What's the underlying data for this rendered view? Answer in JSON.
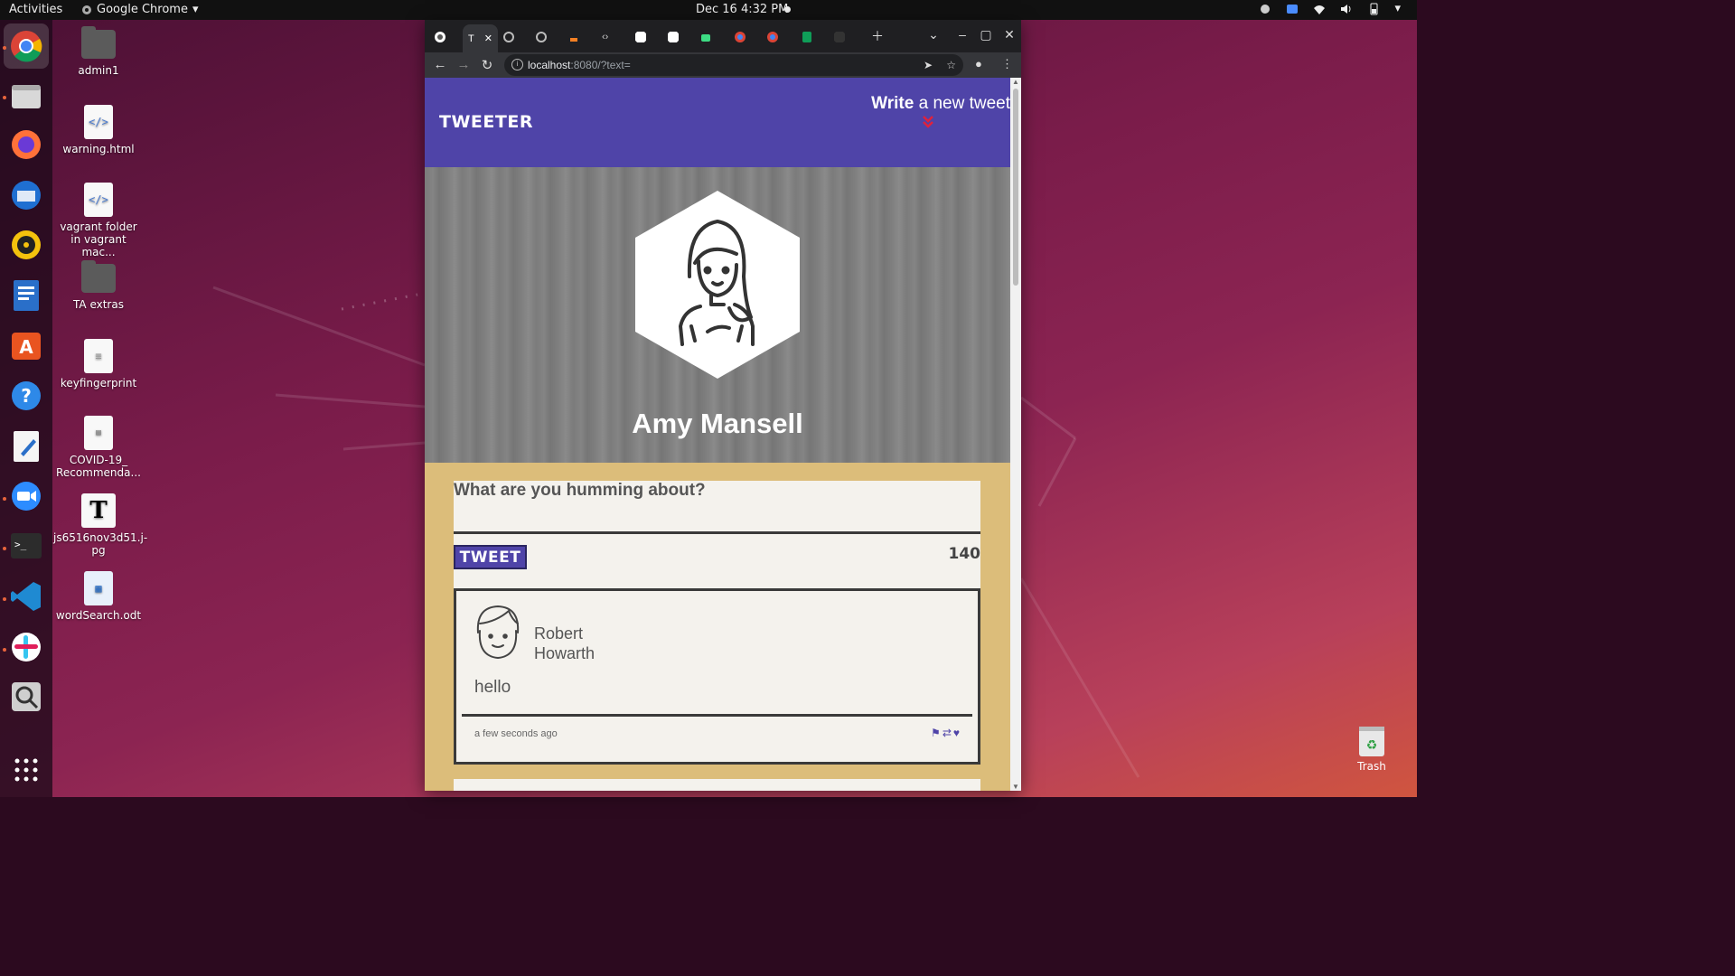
{
  "topbar": {
    "activities": "Activities",
    "app_name": "Google Chrome",
    "clock": "Dec 16  4:32 PM"
  },
  "desktop_icons": [
    {
      "label": "admin1",
      "kind": "home-folder"
    },
    {
      "label": "warning.html",
      "kind": "html-file"
    },
    {
      "label": "vagrant folder in vagrant mac...",
      "kind": "html-file"
    },
    {
      "label": "TA extras",
      "kind": "folder"
    },
    {
      "label": "keyfingerprint",
      "kind": "text-file"
    },
    {
      "label": "COVID-19_ Recommenda...",
      "kind": "document-file"
    },
    {
      "label": "js6516nov3d51.j-pg",
      "kind": "image-file"
    },
    {
      "label": "wordSearch.odt",
      "kind": "odt-file"
    }
  ],
  "trash": {
    "label": "Trash"
  },
  "browser": {
    "tabs": [
      {
        "label": "T",
        "active": true
      }
    ],
    "url_host": "localhost",
    "url_rest": ":8080/?text="
  },
  "site": {
    "brand": "TWEETER",
    "compose_link_bold": "Write",
    "compose_link_rest": " a new tweet",
    "compose_toggle": "⌄⌄"
  },
  "profile": {
    "name": "Amy Mansell"
  },
  "composer": {
    "placeholder": "What are you humming about?",
    "button_label": "TWEET",
    "counter": "140"
  },
  "tweet": {
    "author": "Robert Howarth",
    "body": "hello",
    "timestamp": "a few seconds ago",
    "actions": [
      "flag-icon",
      "retweet-icon",
      "heart-icon"
    ]
  },
  "colors": {
    "nav_purple": "#4f44a8",
    "page_tan": "#dcbd7a",
    "card_bg": "#f4f2ed",
    "toggle_red": "#e0213c"
  }
}
